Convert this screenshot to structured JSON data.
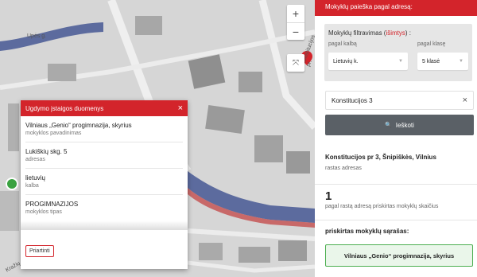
{
  "map": {
    "street_labels": [
      "Upės g.",
      "Konstitucijos pr.",
      "Kražių g."
    ],
    "zoom_in": "+",
    "zoom_out": "−",
    "fullscreen_icon": "⤧"
  },
  "popup": {
    "title": "Ugdymo įstaigos duomenys",
    "close": "×",
    "rows": [
      {
        "value": "Vilniaus „Genio“ progimnazija, skyrius",
        "label": "mokyklos pavadinimas"
      },
      {
        "value": "Lukiškių skg. 5",
        "label": "adresas"
      },
      {
        "value": "lietuvių",
        "label": "kalba"
      },
      {
        "value": "PROGIMNAZIJOS",
        "label": "mokyklos tipas"
      }
    ],
    "zoom_button": "Priartinti"
  },
  "sidebar": {
    "header": "Mokyklų paieška pagal adresą:",
    "filter": {
      "title": "Mokyklų filtravimas (",
      "title_accent": "išimtys",
      "title_end": ") :",
      "lang_label": "pagal kalbą",
      "lang_value": "Lietuvių k.",
      "grade_label": "pagal klasę",
      "grade_value": "5 klasė"
    },
    "search": {
      "value": "Konstitucijos 3",
      "clear": "×",
      "button": "Ieškoti",
      "button_icon": "🔍"
    },
    "found_address": {
      "value": "Konstitucijos pr 3, Šnipiškės, Vilnius",
      "label": "rastas adresas"
    },
    "school_count": {
      "value": "1",
      "label": "pagal rastą adresą priskirtas mokyklų skaičius"
    },
    "list_title": "priskirtas mokyklų sąrašas:",
    "schools": [
      "Vilniaus „Genio“ progimnazija, skyrius"
    ]
  },
  "colors": {
    "accent": "#d3242b",
    "button": "#5a6066",
    "school_border": "#4caf50"
  }
}
